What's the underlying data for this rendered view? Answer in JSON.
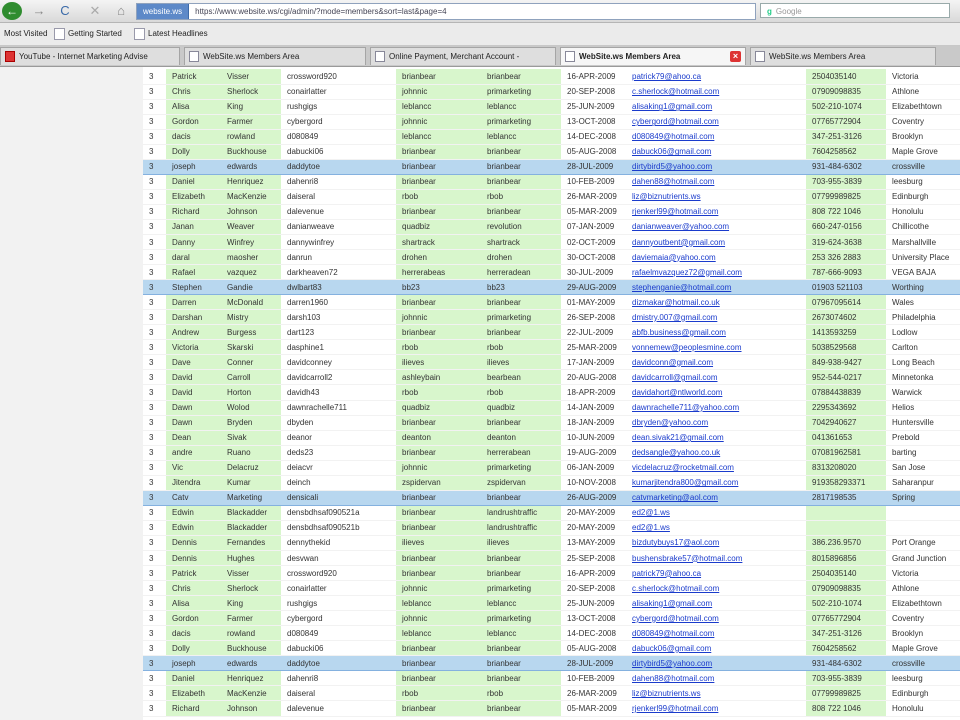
{
  "nav": {
    "back": "←",
    "forward": "→",
    "reload": "C",
    "stop": "✕",
    "home": "⌂",
    "site_identity": "website.ws",
    "url": "https://www.website.ws/cgi/admin/?mode=members&sort=last&page=4"
  },
  "search": {
    "engine": "g",
    "placeholder": "Google"
  },
  "bookmarks": [
    "Most Visited",
    "Getting Started",
    "Latest Headlines"
  ],
  "tabs": [
    "YouTube - Internet Marketing Advise",
    "WebSite.ws Members Area",
    "Online Payment, Merchant Account -",
    "WebSite.ws Members Area",
    "WebSite.ws Members Area"
  ],
  "colors": {
    "green_column": "#d8f6cc",
    "highlight_row": "#b8d7ef",
    "link": "#1a3bcc"
  },
  "rows": [
    [
      "3",
      "Patrick",
      "Visser",
      "crossword920",
      "brianbear",
      "brianbear",
      "16-APR-2009",
      "patrick79@ahoo.ca",
      "2504035140",
      "Victoria"
    ],
    [
      "3",
      "Chris",
      "Sherlock",
      "conairlatter",
      "johnnic",
      "primarketing",
      "20-SEP-2008",
      "c.sherlock@hotmail.com",
      "07909098835",
      "Athlone"
    ],
    [
      "3",
      "Alisa",
      "King",
      "rushgigs",
      "leblancc",
      "leblancc",
      "25-JUN-2009",
      "alisaking1@gmail.com",
      "502-210-1074",
      "Elizabethtown"
    ],
    [
      "3",
      "Gordon",
      "Farmer",
      "cybergord",
      "johnnic",
      "primarketing",
      "13-OCT-2008",
      "cybergord@hotmail.com",
      "07765772904",
      "Coventry"
    ],
    [
      "3",
      "dacis",
      "rowland",
      "d080849",
      "leblancc",
      "leblancc",
      "14-DEC-2008",
      "d080849@hotmail.com",
      "347-251-3126",
      "Brooklyn"
    ],
    [
      "3",
      "Dolly",
      "Buckhouse",
      "dabucki06",
      "brianbear",
      "brianbear",
      "05-AUG-2008",
      "dabuck06@gmail.com",
      "7604258562",
      "Maple Grove"
    ],
    [
      "3",
      "joseph",
      "edwards",
      "daddytoe",
      "brianbear",
      "brianbear",
      "28-JUL-2009",
      "dirtybird5@yahoo.com",
      "931-484-6302",
      "crossville"
    ],
    [
      "3",
      "Daniel",
      "Henriquez",
      "dahenri8",
      "brianbear",
      "brianbear",
      "10-FEB-2009",
      "dahen88@hotmail.com",
      "703-955-3839",
      "leesburg"
    ],
    [
      "3",
      "Elizabeth",
      "MacKenzie",
      "daiseral",
      "rbob",
      "rbob",
      "26-MAR-2009",
      "liz@biznutrients.ws",
      "07799989825",
      "Edinburgh"
    ],
    [
      "3",
      "Richard",
      "Johnson",
      "dalevenue",
      "brianbear",
      "brianbear",
      "05-MAR-2009",
      "rjenkerl99@hotmail.com",
      "808 722 1046",
      "Honolulu"
    ],
    [
      "3",
      "Janan",
      "Weaver",
      "danianweave",
      "quadbiz",
      "revolution",
      "07-JAN-2009",
      "danianweaver@yahoo.com",
      "660-247-0156",
      "Chillicothe"
    ],
    [
      "3",
      "Danny",
      "Winfrey",
      "dannywinfrey",
      "shartrack",
      "shartrack",
      "02-OCT-2009",
      "dannyoutbent@gmail.com",
      "319-624-3638",
      "Marshallville"
    ],
    [
      "3",
      "daral",
      "maosher",
      "danrun",
      "drohen",
      "drohen",
      "30-OCT-2008",
      "daviemaia@yahoo.com",
      "253 326 2883",
      "University Place"
    ],
    [
      "3",
      "Rafael",
      "vazquez",
      "darkheaven72",
      "herrerabeas",
      "herreradean",
      "30-JUL-2009",
      "rafaelmvazquez72@gmail.com",
      "787-666-9093",
      "VEGA BAJA"
    ],
    [
      "3",
      "Stephen",
      "Gandie",
      "dwlbart83",
      "bb23",
      "bb23",
      "29-AUG-2009",
      "stephenganie@hotmail.com",
      "01903 521103",
      "Worthing"
    ],
    [
      "3",
      "Darren",
      "McDonald",
      "darren1960",
      "brianbear",
      "brianbear",
      "01-MAY-2009",
      "dizmakar@hotmail.co.uk",
      "07967095614",
      "Wales"
    ],
    [
      "3",
      "Darshan",
      "Mistry",
      "darsh103",
      "johnnic",
      "primarketing",
      "26-SEP-2008",
      "dmistry.007@gmail.com",
      "2673074602",
      "Philadelphia"
    ],
    [
      "3",
      "Andrew",
      "Burgess",
      "dart123",
      "brianbear",
      "brianbear",
      "22-JUL-2009",
      "abfb.business@gmail.com",
      "1413593259",
      "Lodlow"
    ],
    [
      "3",
      "Victoria",
      "Skarski",
      "dasphine1",
      "rbob",
      "rbob",
      "25-MAR-2009",
      "vonnemew@peoplesmine.com",
      "5038529568",
      "Carlton"
    ],
    [
      "3",
      "Dave",
      "Conner",
      "davidconney",
      "ilieves",
      "ilieves",
      "17-JAN-2009",
      "davidconn@gmail.com",
      "849-938-9427",
      "Long Beach"
    ],
    [
      "3",
      "David",
      "Carroll",
      "davidcarroll2",
      "ashleybain",
      "bearbean",
      "20-AUG-2008",
      "davidcarroll@gmail.com",
      "952-544-0217",
      "Minnetonka"
    ],
    [
      "3",
      "David",
      "Horton",
      "davidh43",
      "rbob",
      "rbob",
      "18-APR-2009",
      "davidahort@ntlworld.com",
      "07884438839",
      "Warwick"
    ],
    [
      "3",
      "Dawn",
      "Wolod",
      "dawnrachelle711",
      "quadbiz",
      "quadbiz",
      "14-JAN-2009",
      "dawnrachelle711@yahoo.com",
      "2295343692",
      "Helios"
    ],
    [
      "3",
      "Dawn",
      "Bryden",
      "dbyden",
      "brianbear",
      "brianbear",
      "18-JAN-2009",
      "dbryden@yahoo.com",
      "7042940627",
      "Huntersville"
    ],
    [
      "3",
      "Dean",
      "Sivak",
      "deanor",
      "deanton",
      "deanton",
      "10-JUN-2009",
      "dean.sivak21@gmail.com",
      "041361653",
      "Prebold"
    ],
    [
      "3",
      "andre",
      "Ruano",
      "deds23",
      "brianbear",
      "herrerabean",
      "19-AUG-2009",
      "dedsangle@yahoo.co.uk",
      "07081962581",
      "barting"
    ],
    [
      "3",
      "Vic",
      "Delacruz",
      "deiacvr",
      "johnnic",
      "primarketing",
      "06-JAN-2009",
      "vicdelacruz@rocketmail.com",
      "8313208020",
      "San Jose"
    ],
    [
      "3",
      "Jitendra",
      "Kumar",
      "deinch",
      "zspidervan",
      "zspidervan",
      "10-NOV-2008",
      "kumarjitendra800@gmail.com",
      "919358293371",
      "Saharanpur"
    ],
    [
      "3",
      "Catv",
      "Marketing",
      "densicali",
      "brianbear",
      "brianbear",
      "26-AUG-2009",
      "catvmarketing@aol.com",
      "2817198535",
      "Spring"
    ],
    [
      "3",
      "Edwin",
      "Blackadder",
      "densbdhsaf090521a",
      "brianbear",
      "landrushtraffic",
      "20-MAY-2009",
      "ed2@1.ws",
      "",
      ""
    ],
    [
      "3",
      "Edwin",
      "Blackadder",
      "densbdhsaf090521b",
      "brianbear",
      "landrushtraffic",
      "20-MAY-2009",
      "ed2@1.ws",
      "",
      ""
    ],
    [
      "3",
      "Dennis",
      "Fernandes",
      "dennythekid",
      "ilieves",
      "ilieves",
      "13-MAY-2009",
      "bizdutybuys17@aol.com",
      "386.236.9570",
      "Port Orange"
    ],
    [
      "3",
      "Dennis",
      "Hughes",
      "desvwan",
      "brianbear",
      "brianbear",
      "25-SEP-2008",
      "bushensbrake57@hotmail.com",
      "8015896856",
      "Grand Junction"
    ],
    [
      "3",
      "Patrick",
      "Visser",
      "crossword920",
      "brianbear",
      "brianbear",
      "16-APR-2009",
      "patrick79@ahoo.ca",
      "2504035140",
      "Victoria"
    ],
    [
      "3",
      "Chris",
      "Sherlock",
      "conairlatter",
      "johnnic",
      "primarketing",
      "20-SEP-2008",
      "c.sherlock@hotmail.com",
      "07909098835",
      "Athlone"
    ],
    [
      "3",
      "Alisa",
      "King",
      "rushgigs",
      "leblancc",
      "leblancc",
      "25-JUN-2009",
      "alisaking1@gmail.com",
      "502-210-1074",
      "Elizabethtown"
    ],
    [
      "3",
      "Gordon",
      "Farmer",
      "cybergord",
      "johnnic",
      "primarketing",
      "13-OCT-2008",
      "cybergord@hotmail.com",
      "07765772904",
      "Coventry"
    ],
    [
      "3",
      "dacis",
      "rowland",
      "d080849",
      "leblancc",
      "leblancc",
      "14-DEC-2008",
      "d080849@hotmail.com",
      "347-251-3126",
      "Brooklyn"
    ],
    [
      "3",
      "Dolly",
      "Buckhouse",
      "dabucki06",
      "brianbear",
      "brianbear",
      "05-AUG-2008",
      "dabuck06@gmail.com",
      "7604258562",
      "Maple Grove"
    ],
    [
      "3",
      "joseph",
      "edwards",
      "daddytoe",
      "brianbear",
      "brianbear",
      "28-JUL-2009",
      "dirtybird5@yahoo.com",
      "931-484-6302",
      "crossville"
    ],
    [
      "3",
      "Daniel",
      "Henriquez",
      "dahenri8",
      "brianbear",
      "brianbear",
      "10-FEB-2009",
      "dahen88@hotmail.com",
      "703-955-3839",
      "leesburg"
    ],
    [
      "3",
      "Elizabeth",
      "MacKenzie",
      "daiseral",
      "rbob",
      "rbob",
      "26-MAR-2009",
      "liz@biznutrients.ws",
      "07799989825",
      "Edinburgh"
    ],
    [
      "3",
      "Richard",
      "Johnson",
      "dalevenue",
      "brianbear",
      "brianbear",
      "05-MAR-2009",
      "rjenkerl99@hotmail.com",
      "808 722 1046",
      "Honolulu"
    ]
  ],
  "highlighted_rows": [
    6,
    14,
    28,
    39
  ]
}
